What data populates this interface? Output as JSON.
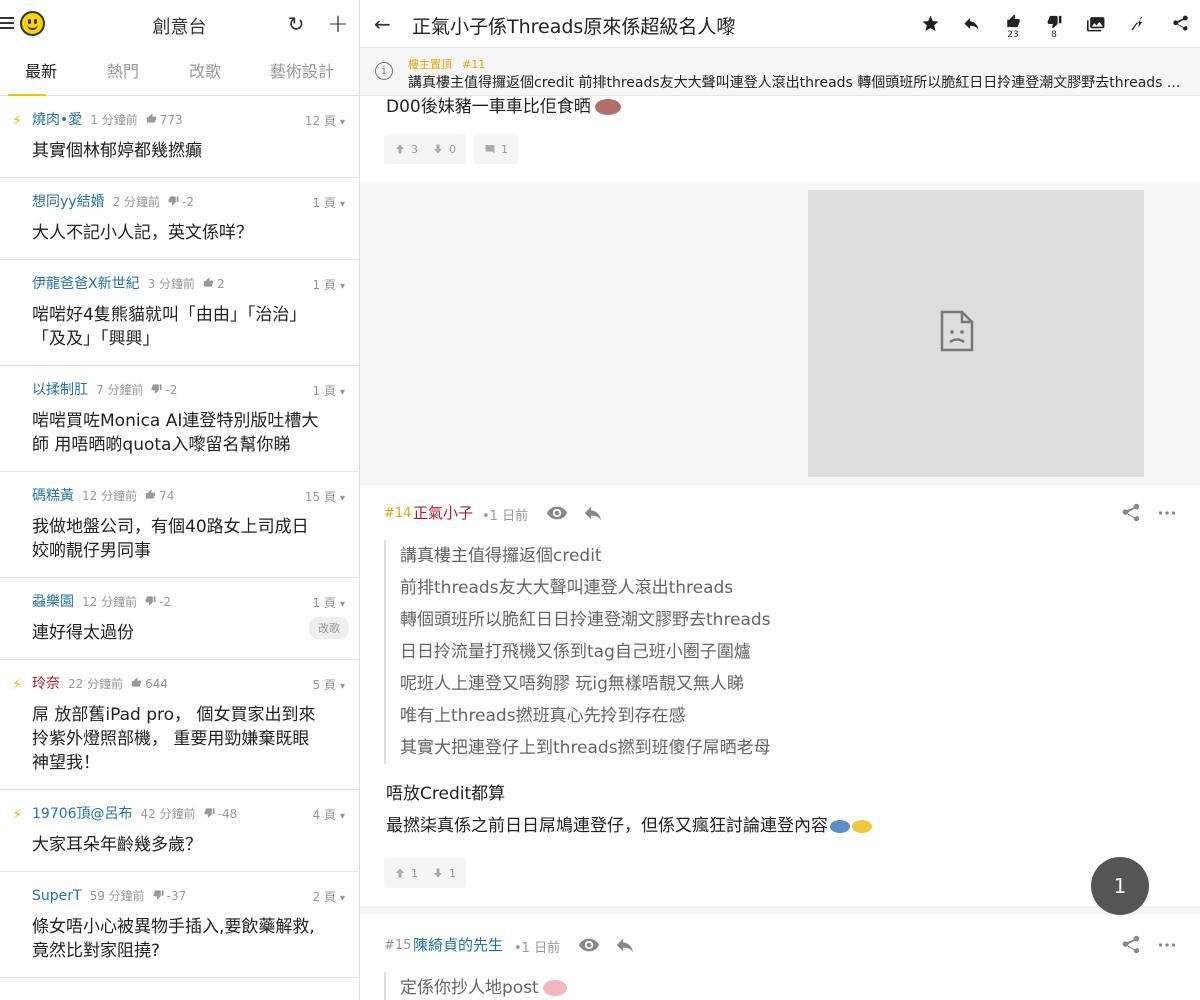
{
  "sidebar": {
    "title": "創意台",
    "tabs": [
      "最新",
      "熱門",
      "改歌",
      "藝術設計"
    ],
    "topics": [
      {
        "user": "燒肉•愛",
        "time": "1 分鐘前",
        "score": "773",
        "score_type": "up",
        "pages": "12 頁",
        "title": "其實個林郁婷都幾撚癲",
        "hot": true
      },
      {
        "user": "想同yy結婚",
        "time": "2 分鐘前",
        "score": "-2",
        "score_type": "down",
        "pages": "1 頁",
        "title": "大人不記小人記，英文係咩？",
        "hot": false
      },
      {
        "user": "伊龍爸爸X新世紀",
        "time": "3 分鐘前",
        "score": "2",
        "score_type": "up",
        "pages": "1 頁",
        "title": "啱啱好4隻熊貓就叫「由由」「治治」「及及」「興興」",
        "hot": false
      },
      {
        "user": "以揉制肛",
        "time": "7 分鐘前",
        "score": "-2",
        "score_type": "down",
        "pages": "1 頁",
        "title": "啱啱買咗Monica AI連登特別版吐槽大師 用唔晒啲quota入嚟留名幫你睇",
        "hot": false
      },
      {
        "user": "碼糕黃",
        "time": "12 分鐘前",
        "score": "74",
        "score_type": "up",
        "pages": "15 頁",
        "title": "我做地盤公司，有個40路女上司成日姣啲靚仔男同事",
        "hot": false
      },
      {
        "user": "蝨樂園",
        "time": "12 分鐘前",
        "score": "-2",
        "score_type": "down",
        "pages": "1 頁",
        "title": "連好得太過份",
        "hot": false,
        "tag": "改歌"
      },
      {
        "user": "玲奈",
        "time": "22 分鐘前",
        "score": "644",
        "score_type": "up",
        "pages": "5 頁",
        "title": "屌 放部舊iPad pro， 個女買家出到來拎紫外燈照部機， 重要用勁嫌棄既眼神望我！",
        "hot": true,
        "red": true
      },
      {
        "user": "19706頂@呂布",
        "time": "42 分鐘前",
        "score": "-48",
        "score_type": "down",
        "pages": "4 頁",
        "title": "大家耳朵年齡幾多歲？",
        "hot": true
      },
      {
        "user": "SuperT",
        "time": "59 分鐘前",
        "score": "-37",
        "score_type": "down",
        "pages": "2 頁",
        "title": "條女唔小心被異物手插入,要飲藥解救,竟然比對家阻撓?",
        "hot": false
      }
    ]
  },
  "main": {
    "thread_title": "正氣小子係Threads原來係超級名人嚟",
    "like_count": "23",
    "dislike_count": "8",
    "pinned": {
      "label": "樓主置頂",
      "floor": "#11",
      "text": "講真樓主值得攞返個credit 前排threads友大大聲叫連登人滾出threads 轉個頭班所以脆紅日日拎連登潮文膠野去threads ..."
    },
    "prev_post": {
      "text": "D00後妹豬一車車比佢食晒",
      "up": "3",
      "down": "0",
      "comments": "1"
    },
    "post14": {
      "floor": "#14",
      "author": "正氣小子",
      "time": "1 日前",
      "quote": [
        "講真樓主值得攞返個credit",
        "前排threads友大大聲叫連登人滾出threads",
        "轉個頭班所以脆紅日日拎連登潮文膠野去threads",
        "日日拎流量打飛機又係到tag自己班小圈子圍爐",
        "呢班人上連登又唔夠膠 玩ig無樣唔靚又無人睇",
        "唯有上threads撚班真心先拎到存在感",
        "其實大把連登仔上到threads撚到班傻仔屌晒老母"
      ],
      "body": [
        "唔放Credit都算",
        "最撚柒真係之前日日屌鳩連登仔，但係又瘋狂討論連登內容"
      ],
      "up": "1",
      "down": "1"
    },
    "post15": {
      "floor": "#15",
      "author": "陳綺貞的先生",
      "time": "1 日前",
      "quote": [
        "定係你抄人地post"
      ]
    },
    "page_fab": "1"
  }
}
